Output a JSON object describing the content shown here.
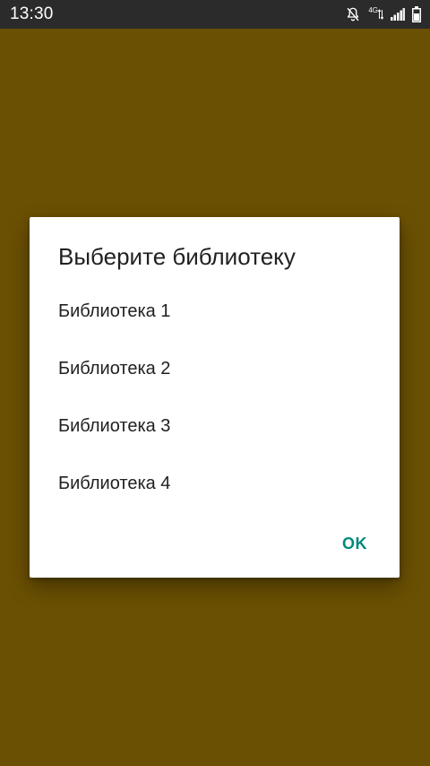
{
  "status_bar": {
    "time": "13:30",
    "network_label": "4G",
    "icons": [
      "bell-off-icon",
      "signal-icon",
      "battery-icon"
    ]
  },
  "colors": {
    "background": "#6a5003",
    "status_bar": "#2b2b2b",
    "dialog": "#ffffff",
    "accent": "#00897b",
    "text": "#212121"
  },
  "dialog": {
    "title": "Выберите библиотеку",
    "items": [
      {
        "label": "Библиотека 1"
      },
      {
        "label": "Библиотека 2"
      },
      {
        "label": "Библиотека 3"
      },
      {
        "label": "Библиотека 4"
      }
    ],
    "ok_label": "OK"
  }
}
